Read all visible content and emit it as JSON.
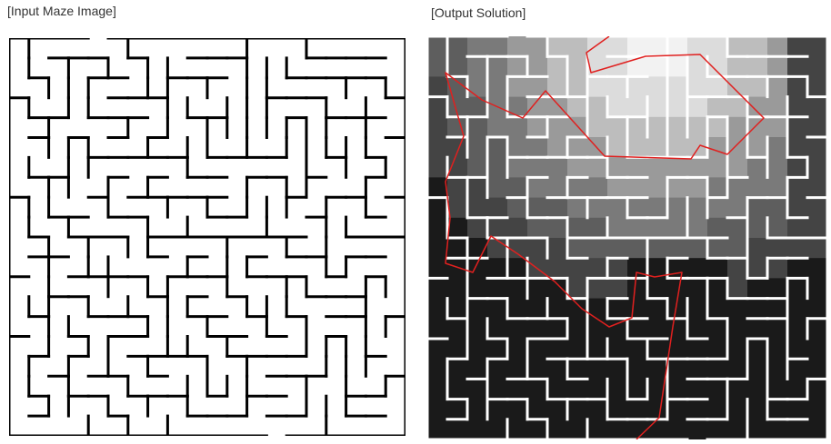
{
  "labels": {
    "input": "[Input Maze Image]",
    "output": "[Output Solution]"
  },
  "colors": {
    "wall_input": "#000000",
    "wall_output": "#ffffff",
    "solution_path": "#e0201f",
    "region_shades": [
      "#f2f2f2",
      "#dcdcdc",
      "#bdbdbd",
      "#9a9a9a",
      "#7a7a7a",
      "#5e5e5e",
      "#444444",
      "#1a1a1a"
    ]
  },
  "maze": {
    "grid": "20x20"
  }
}
